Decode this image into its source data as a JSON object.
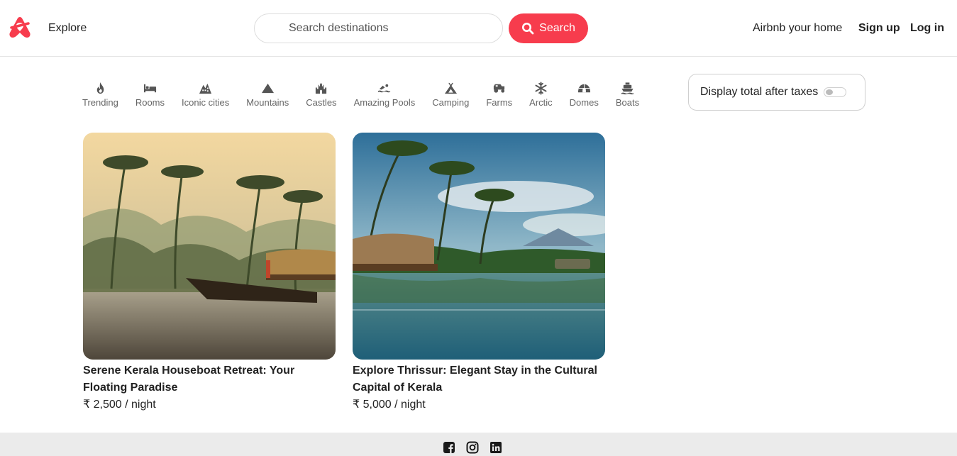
{
  "header": {
    "explore_label": "Explore",
    "search_placeholder": "Search destinations",
    "search_button": "Search",
    "host_link": "Airbnb your home",
    "signup": "Sign up",
    "login": "Log in",
    "brand_color": "#f73c4d"
  },
  "categories": [
    {
      "label": "Trending",
      "icon": "fire-icon"
    },
    {
      "label": "Rooms",
      "icon": "bed-icon"
    },
    {
      "label": "Iconic cities",
      "icon": "city-icon"
    },
    {
      "label": "Mountains",
      "icon": "mountain-icon"
    },
    {
      "label": "Castles",
      "icon": "castle-icon"
    },
    {
      "label": "Amazing Pools",
      "icon": "pool-icon"
    },
    {
      "label": "Camping",
      "icon": "tent-icon"
    },
    {
      "label": "Farms",
      "icon": "tractor-icon"
    },
    {
      "label": "Arctic",
      "icon": "snowflake-icon"
    },
    {
      "label": "Domes",
      "icon": "igloo-icon"
    },
    {
      "label": "Boats",
      "icon": "ship-icon"
    }
  ],
  "tax_toggle": {
    "label": "Display total after taxes",
    "enabled": false
  },
  "listings": [
    {
      "title": "Serene Kerala Houseboat Retreat: Your Floating Paradise",
      "price": "₹ 2,500 / night"
    },
    {
      "title": "Explore Thrissur: Elegant Stay in the Cultural Capital of Kerala",
      "price": "₹ 5,000 / night"
    }
  ],
  "footer": {
    "social_icons": [
      "facebook-icon",
      "instagram-icon",
      "linkedin-icon"
    ]
  }
}
